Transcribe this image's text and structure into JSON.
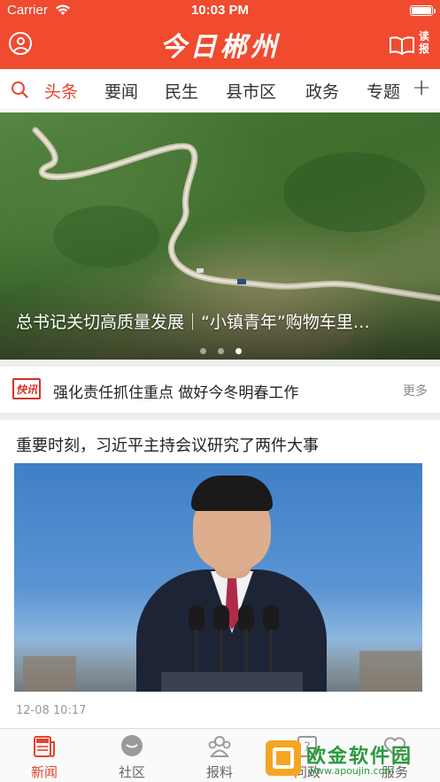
{
  "status_bar": {
    "carrier": "Carrier",
    "time": "10:03 PM",
    "battery_level": 1.0
  },
  "header": {
    "logo_text": "今日郴州",
    "user_icon": "user-circle-icon",
    "read_label": "读报",
    "read_icon": "open-book-icon",
    "background_color": "#f04a2f"
  },
  "tabs": {
    "search_icon": "search-icon",
    "items": [
      {
        "label": "头条",
        "active": true
      },
      {
        "label": "要闻",
        "active": false
      },
      {
        "label": "民生",
        "active": false
      },
      {
        "label": "县市区",
        "active": false
      },
      {
        "label": "政务",
        "active": false
      },
      {
        "label": "专题",
        "active": false
      }
    ],
    "add_label": "+",
    "active_color": "#e6432d"
  },
  "banner": {
    "caption": "总书记关切高质量发展｜“小镇青年”购物车里…",
    "dot_count": 3,
    "active_dot": 2
  },
  "flash": {
    "badge": "快讯",
    "headline": "强化责任抓住重点 做好今冬明春工作",
    "more": "更多"
  },
  "article": {
    "title": "重要时刻，习近平主持会议研究了两件大事",
    "date": "12-08 10:17"
  },
  "tabbar": {
    "items": [
      {
        "label": "新闻",
        "icon": "news-icon",
        "active": true
      },
      {
        "label": "社区",
        "icon": "chat-bubble-icon",
        "active": false
      },
      {
        "label": "报料",
        "icon": "group-icon",
        "active": false
      },
      {
        "label": "问政",
        "icon": "question-icon",
        "active": false
      },
      {
        "label": "服务",
        "icon": "heart-icon",
        "active": false
      }
    ]
  },
  "watermark": {
    "text": "欧金软件园",
    "url": "www.apoujin.com"
  }
}
